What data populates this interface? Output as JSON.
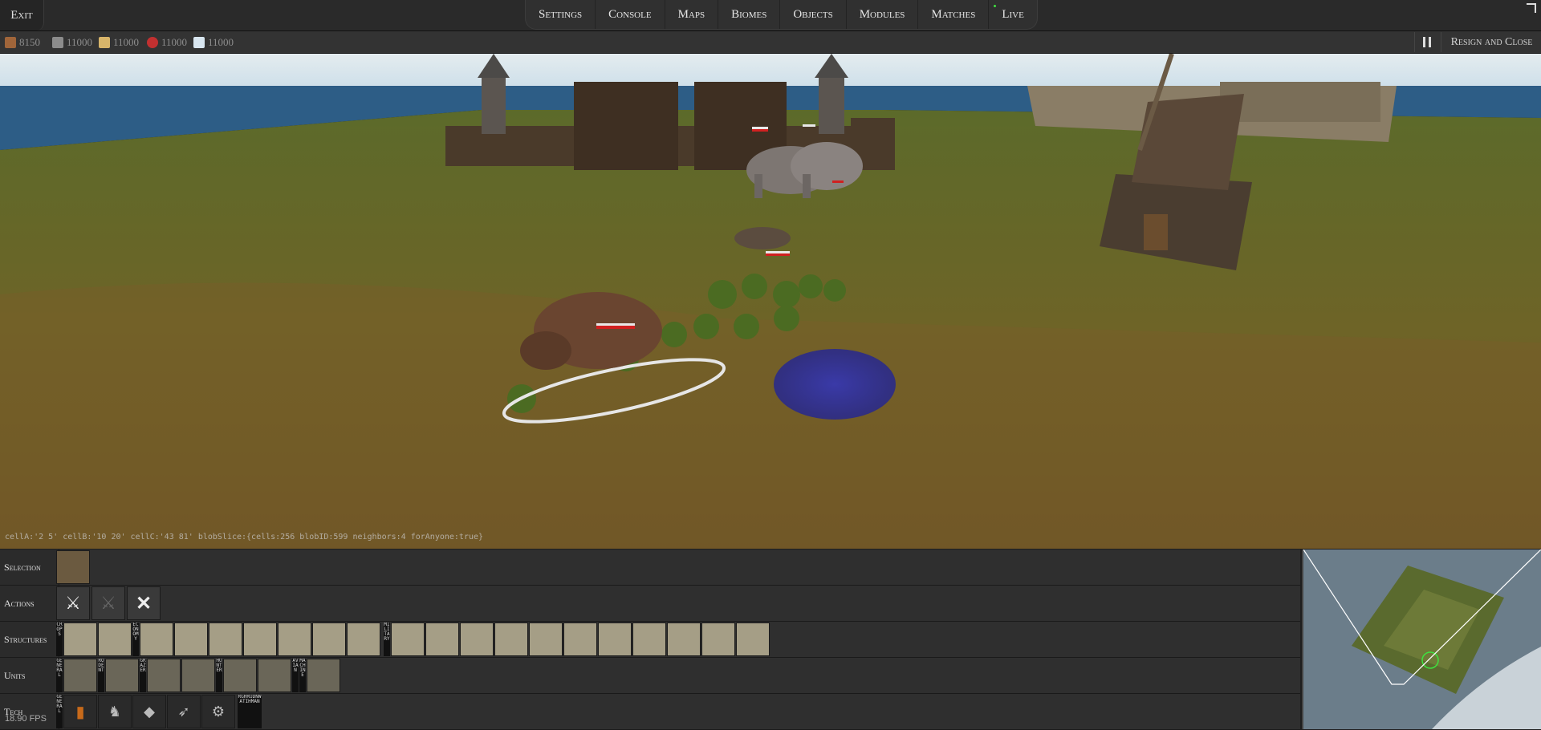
{
  "topbar": {
    "exit_label": "Exit",
    "menu": [
      "Settings",
      "Console",
      "Maps",
      "Biomes",
      "Objects",
      "Modules",
      "Matches",
      "Live"
    ]
  },
  "resources": [
    {
      "icon": "wood-icon",
      "value": "8150",
      "color": "#a0653a"
    },
    {
      "icon": "stone-icon",
      "value": "11000",
      "color": "#8c8c8c"
    },
    {
      "icon": "wheat-icon",
      "value": "11000",
      "color": "#d8b56a"
    },
    {
      "icon": "berry-icon",
      "value": "11000",
      "color": "#c23030"
    },
    {
      "icon": "ice-icon",
      "value": "11000",
      "color": "#d8e6f0"
    }
  ],
  "controls": {
    "resign_label": "Resign and Close"
  },
  "debug_text": "cellA:'2 5' cellB:'10 20' cellC:'43 81' blobSlice:{cells:256 blobID:599 neighbors:4 forAnyone:true}",
  "panel": {
    "rows": {
      "selection": "Selection",
      "actions": "Actions",
      "structures": "Structures",
      "units": "Units",
      "tech": "Tech"
    },
    "structure_categories": [
      "CROPS",
      "ECONOMY",
      "MILITARY"
    ],
    "unit_categories": [
      "GENERAL",
      "RODENT",
      "GRAZER",
      "HUNTER",
      "AVIAN",
      "MACHINE"
    ],
    "tech_categories": [
      "GENERAL",
      "RGHRUDNWATIHMAN"
    ]
  },
  "fps": "18.90 FPS",
  "colors": {
    "accent": "#3fe03f",
    "health_red": "#d02020",
    "water": "#2d5d86",
    "grass": "#6d7a2c"
  }
}
